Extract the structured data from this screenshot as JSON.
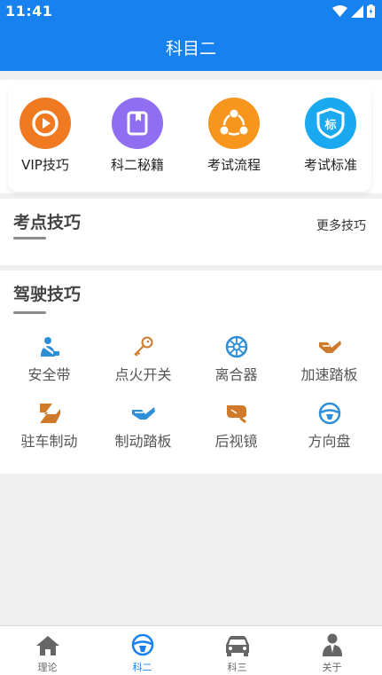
{
  "status_bar": {
    "time": "11:41"
  },
  "app_bar": {
    "title": "科目二"
  },
  "quick_entries": [
    {
      "label": "VIP技巧",
      "color": "#f07a22",
      "icon": "play-circle-icon"
    },
    {
      "label": "科二秘籍",
      "color": "#8f6ef2",
      "icon": "book-icon"
    },
    {
      "label": "考试流程",
      "color": "#f7951d",
      "icon": "flow-icon"
    },
    {
      "label": "考试标准",
      "color": "#1aa9f0",
      "icon": "shield-badge-icon",
      "badge_text": "标"
    }
  ],
  "tips_section": {
    "title": "考点技巧",
    "more_label": "更多技巧"
  },
  "driving_section": {
    "title": "驾驶技巧",
    "items": [
      {
        "label": "安全带",
        "icon": "seatbelt-icon"
      },
      {
        "label": "点火开关",
        "icon": "key-icon"
      },
      {
        "label": "离合器",
        "icon": "clutch-icon"
      },
      {
        "label": "加速踏板",
        "icon": "accelerator-pedal-icon"
      },
      {
        "label": "驻车制动",
        "icon": "handbrake-icon"
      },
      {
        "label": "制动踏板",
        "icon": "brake-pedal-icon"
      },
      {
        "label": "后视镜",
        "icon": "mirror-icon"
      },
      {
        "label": "方向盘",
        "icon": "steering-wheel-icon"
      }
    ]
  },
  "tab_bar": {
    "active_index": 1,
    "tabs": [
      {
        "label": "理论",
        "icon": "home-icon"
      },
      {
        "label": "科二",
        "icon": "steering-wheel-icon"
      },
      {
        "label": "科三",
        "icon": "car-icon"
      },
      {
        "label": "关于",
        "icon": "person-icon"
      }
    ]
  },
  "colors": {
    "primary": "#1781f0",
    "icon_orange": "#cf7a2a",
    "icon_blue": "#2f8fd6",
    "tab_gray": "#666666"
  }
}
